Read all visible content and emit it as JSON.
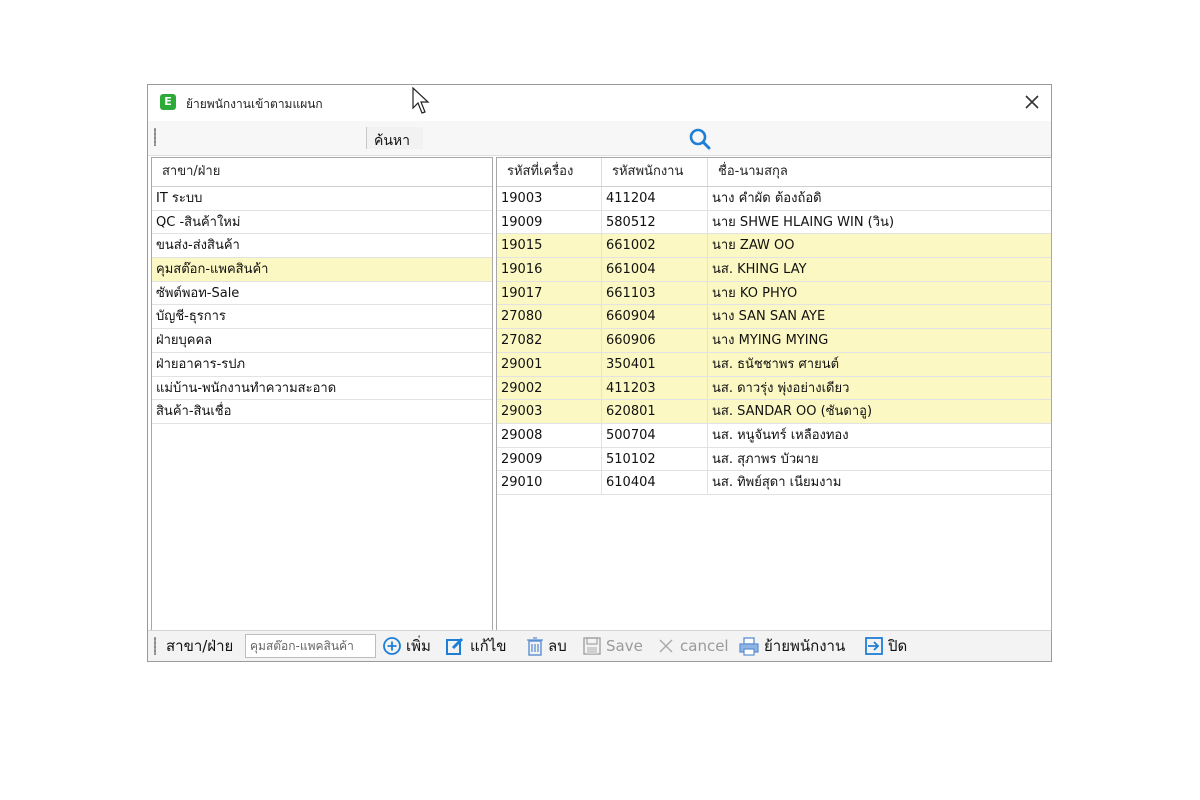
{
  "window": {
    "title": "ย้ายพนักงานเข้าตามแผนก",
    "app_icon": "E"
  },
  "search": {
    "label": "ค้นหา"
  },
  "departments": {
    "header": "สาขา/ฝ่าย",
    "items": [
      {
        "label": "IT ระบบ",
        "selected": false
      },
      {
        "label": "QC -สินค้าใหม่",
        "selected": false
      },
      {
        "label": "ขนส่ง-ส่งสินค้า",
        "selected": false
      },
      {
        "label": "คุมสต๊อก-แพคสินค้า",
        "selected": true
      },
      {
        "label": "ซัพต์พอท-Sale",
        "selected": false
      },
      {
        "label": "บัญชี-ธุรการ",
        "selected": false
      },
      {
        "label": "ฝ่ายบุคคล",
        "selected": false
      },
      {
        "label": "ฝ่ายอาคาร-รปภ",
        "selected": false
      },
      {
        "label": "แม่บ้าน-พนักงานทำความสะอาด",
        "selected": false
      },
      {
        "label": "สินค้า-สินเชื่อ",
        "selected": false
      }
    ]
  },
  "employees": {
    "headers": [
      "รหัสที่เครื่อง",
      "รหัสพนักงาน",
      "ชื่อ-นามสกุล"
    ],
    "rows": [
      {
        "machine_id": "19003",
        "emp_id": "411204",
        "name": "นาง คำผัด ต้องถ้อดิ",
        "highlight": false
      },
      {
        "machine_id": "19009",
        "emp_id": "580512",
        "name": "นาย SHWE HLAING WIN (วิน)",
        "highlight": false
      },
      {
        "machine_id": "19015",
        "emp_id": "661002",
        "name": "นาย ZAW OO",
        "highlight": true
      },
      {
        "machine_id": "19016",
        "emp_id": "661004",
        "name": "นส. KHING LAY",
        "highlight": true
      },
      {
        "machine_id": "19017",
        "emp_id": "661103",
        "name": "นาย KO PHYO",
        "highlight": true
      },
      {
        "machine_id": "27080",
        "emp_id": "660904",
        "name": "นาง SAN SAN AYE",
        "highlight": true
      },
      {
        "machine_id": "27082",
        "emp_id": "660906",
        "name": "นาง MYING MYING",
        "highlight": true
      },
      {
        "machine_id": "29001",
        "emp_id": "350401",
        "name": "นส. ธนัชชาพร ศายนต์",
        "highlight": true
      },
      {
        "machine_id": "29002",
        "emp_id": "411203",
        "name": "นส. ดาวรุ่ง พุ่งอย่างเดียว",
        "highlight": true
      },
      {
        "machine_id": "29003",
        "emp_id": "620801",
        "name": "นส. SANDAR OO (ซันดาอู)",
        "highlight": true
      },
      {
        "machine_id": "29008",
        "emp_id": "500704",
        "name": "นส. หนูจันทร์ เหลืองทอง",
        "highlight": false
      },
      {
        "machine_id": "29009",
        "emp_id": "510102",
        "name": "นส. สุภาพร บัวผาย",
        "highlight": false
      },
      {
        "machine_id": "29010",
        "emp_id": "610404",
        "name": "นส. ทิพย์สุดา เนียมงาม",
        "highlight": false
      }
    ]
  },
  "toolbar": {
    "dept_label": "สาขา/ฝ่าย",
    "dept_value": "คุมสต๊อก-แพคสินค้า",
    "add": "เพิ่ม",
    "edit": "แก้ไข",
    "delete": "ลบ",
    "save": "Save",
    "cancel": "cancel",
    "move": "ย้ายพนักงาน",
    "close": "ปิด"
  },
  "colors": {
    "highlight_row": "#fcf8c3",
    "accent_blue": "#1f7fd6",
    "app_green": "#2eaa3a"
  },
  "icons": [
    "app-icon",
    "close-icon",
    "search-icon",
    "add-icon",
    "edit-icon",
    "trash-icon",
    "save-icon",
    "cancel-icon",
    "printer-icon",
    "exit-icon",
    "mouse-cursor-icon"
  ]
}
